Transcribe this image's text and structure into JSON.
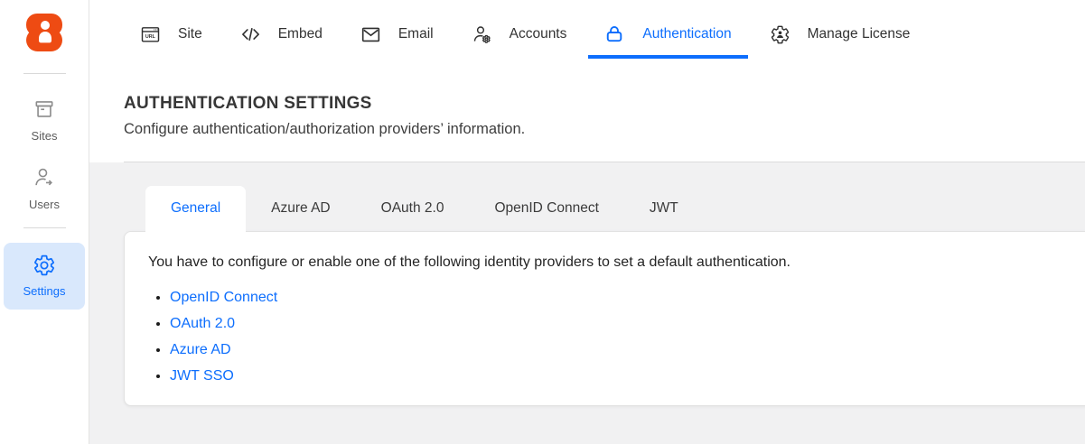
{
  "colors": {
    "accent_blue": "#0d6efd",
    "brand_orange": "#ee4b13",
    "active_item_bg": "#d9e8fc"
  },
  "sidebar": {
    "logo_icon": "bold-b-person-logo",
    "items": [
      {
        "label": "Sites",
        "icon": "archive-box-icon",
        "active": false
      },
      {
        "label": "Users",
        "icon": "user-arrow-icon",
        "active": false
      },
      {
        "label": "Settings",
        "icon": "gear-icon",
        "active": true
      }
    ]
  },
  "topnav": {
    "items": [
      {
        "label": "Site",
        "icon": "browser-url-icon",
        "active": false
      },
      {
        "label": "Embed",
        "icon": "code-brackets-icon",
        "active": false
      },
      {
        "label": "Email",
        "icon": "envelope-icon",
        "active": false
      },
      {
        "label": "Accounts",
        "icon": "user-gear-icon",
        "active": false
      },
      {
        "label": "Authentication",
        "icon": "lock-icon",
        "active": true
      },
      {
        "label": "Manage License",
        "icon": "gear-person-icon",
        "active": false
      }
    ]
  },
  "header": {
    "title": "AUTHENTICATION SETTINGS",
    "subtitle": "Configure authentication/authorization providers’ information."
  },
  "tabs": {
    "items": [
      {
        "label": "General",
        "active": true
      },
      {
        "label": "Azure AD",
        "active": false
      },
      {
        "label": "OAuth 2.0",
        "active": false
      },
      {
        "label": "OpenID Connect",
        "active": false
      },
      {
        "label": "JWT",
        "active": false
      }
    ]
  },
  "panel": {
    "intro": "You have to configure or enable one of the following identity providers to set a default authentication.",
    "links": [
      {
        "label": "OpenID Connect"
      },
      {
        "label": "OAuth 2.0"
      },
      {
        "label": "Azure AD"
      },
      {
        "label": "JWT SSO"
      }
    ]
  }
}
